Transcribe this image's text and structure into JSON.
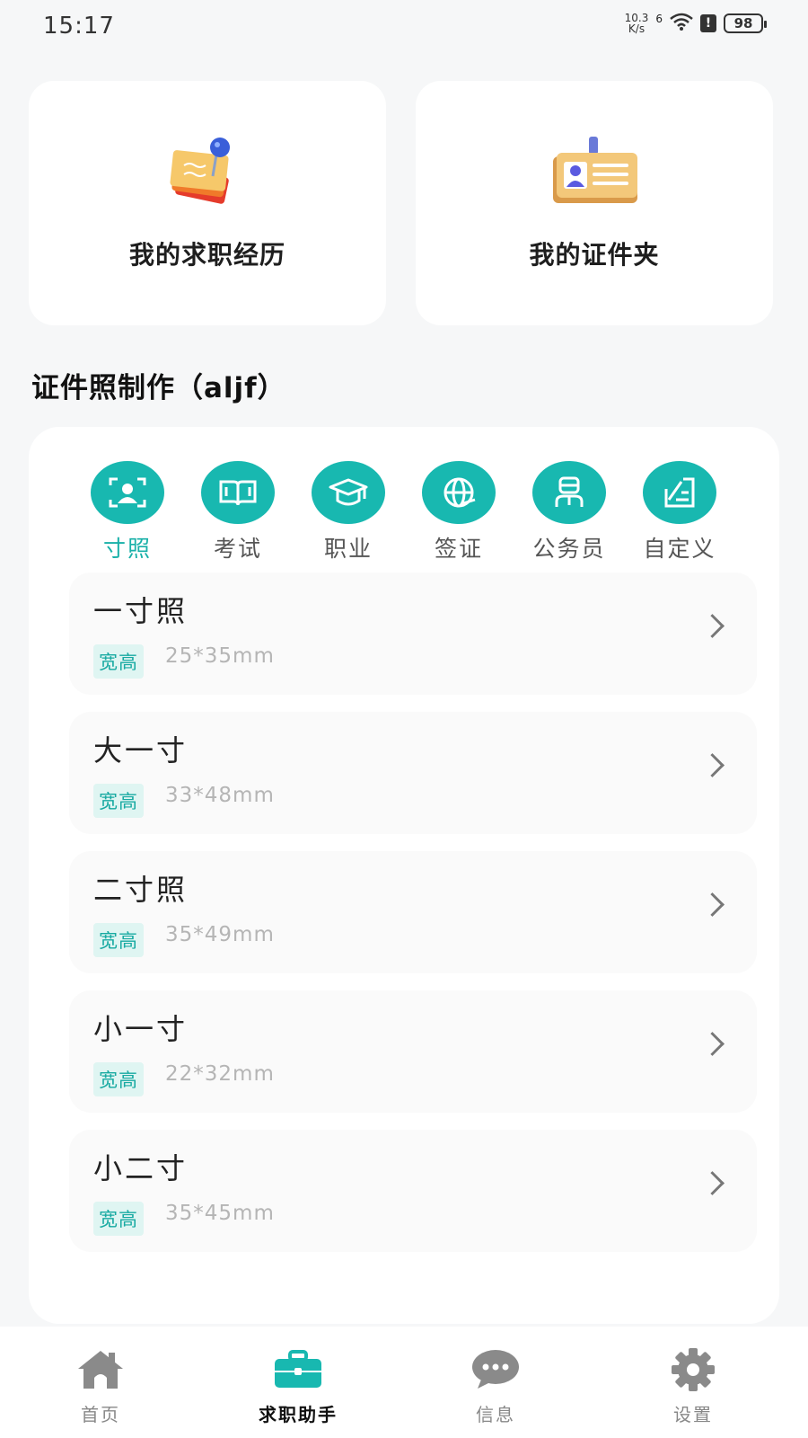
{
  "status_bar": {
    "time": "15:17",
    "net_speed_top": "10.3",
    "net_speed_bottom": "K/s",
    "signal_mark": "6",
    "alert": "!",
    "battery": "98"
  },
  "top_cards": [
    {
      "label": "我的求职经历",
      "icon": "resume-icon"
    },
    {
      "label": "我的证件夹",
      "icon": "id-card-icon"
    }
  ],
  "section_title": "证件照制作（aljf）",
  "categories": [
    {
      "label": "寸照",
      "icon": "portrait-icon",
      "active": true
    },
    {
      "label": "考试",
      "icon": "book-icon",
      "active": false
    },
    {
      "label": "职业",
      "icon": "graduation-cap-icon",
      "active": false
    },
    {
      "label": "签证",
      "icon": "globe-icon",
      "active": false
    },
    {
      "label": "公务员",
      "icon": "officer-icon",
      "active": false
    },
    {
      "label": "自定义",
      "icon": "edit-icon",
      "active": false
    }
  ],
  "sizes": [
    {
      "name": "一寸照",
      "tag": "宽高",
      "dim": "25*35mm"
    },
    {
      "name": "大一寸",
      "tag": "宽高",
      "dim": "33*48mm"
    },
    {
      "name": "二寸照",
      "tag": "宽高",
      "dim": "35*49mm"
    },
    {
      "name": "小一寸",
      "tag": "宽高",
      "dim": "22*32mm"
    },
    {
      "name": "小二寸",
      "tag": "宽高",
      "dim": "35*45mm"
    }
  ],
  "nav": [
    {
      "label": "首页",
      "icon": "home-icon",
      "active": false
    },
    {
      "label": "求职助手",
      "icon": "briefcase-icon",
      "active": true
    },
    {
      "label": "信息",
      "icon": "chat-icon",
      "active": false
    },
    {
      "label": "设置",
      "icon": "gear-icon",
      "active": false
    }
  ],
  "colors": {
    "accent": "#18b8b0",
    "nav_inactive": "#888888",
    "background": "#f6f7f8"
  }
}
